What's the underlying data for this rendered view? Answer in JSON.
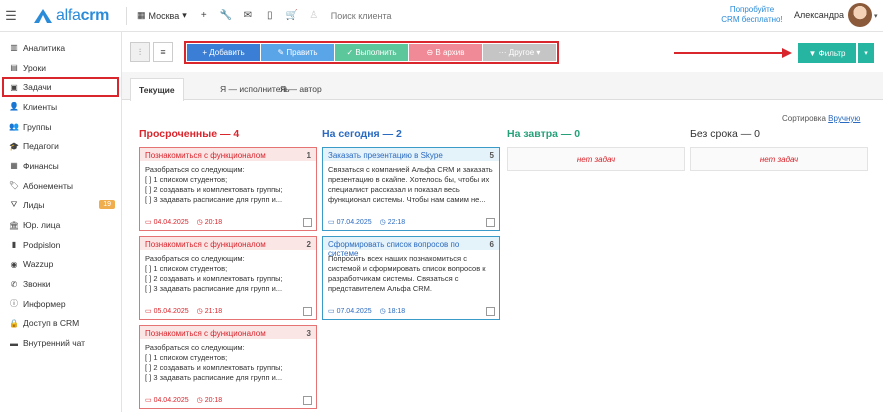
{
  "header": {
    "logo_light": "alfa",
    "logo_bold": "crm",
    "city": "Москва",
    "search_placeholder": "Поиск клиента",
    "promo_line1": "Попробуйте",
    "promo_line2": "CRM бесплатно!",
    "user_name": "Александра"
  },
  "sidebar": {
    "items": [
      {
        "label": "Аналитика",
        "icon": "chart-icon"
      },
      {
        "label": "Уроки",
        "icon": "lessons-icon"
      },
      {
        "label": "Задачи",
        "icon": "tasks-icon"
      },
      {
        "label": "Клиенты",
        "icon": "clients-icon"
      },
      {
        "label": "Группы",
        "icon": "groups-icon"
      },
      {
        "label": "Педагоги",
        "icon": "teachers-icon"
      },
      {
        "label": "Финансы",
        "icon": "finance-icon"
      },
      {
        "label": "Абонементы",
        "icon": "subscriptions-icon"
      },
      {
        "label": "Лиды",
        "icon": "leads-icon",
        "badge": "19"
      },
      {
        "label": "Юр. лица",
        "icon": "legal-icon"
      },
      {
        "label": "Podpislon",
        "icon": "document-icon"
      },
      {
        "label": "Wazzup",
        "icon": "whatsapp-icon"
      },
      {
        "label": "Звонки",
        "icon": "phone-icon"
      },
      {
        "label": "Информер",
        "icon": "informer-icon"
      },
      {
        "label": "Доступ в CRM",
        "icon": "lock-icon"
      },
      {
        "label": "Внутренний чат",
        "icon": "chat-icon"
      }
    ]
  },
  "toolbar": {
    "add": "+ Добавить",
    "edit": "✎ Править",
    "done": "✓ Выполнить",
    "archive": "⊖ В архив",
    "other": "··· Другое ▾",
    "filter": "▼ Фильтр"
  },
  "tabs": [
    "Текущие",
    "Я — исполнитель",
    "Я — автор"
  ],
  "sorting": {
    "label": "Сортировка",
    "value": "Вручную"
  },
  "columns": [
    {
      "title": "Просроченные — 4"
    },
    {
      "title": "На сегодня — 2"
    },
    {
      "title": "На завтра — 0",
      "empty": "нет задач"
    },
    {
      "title": "Без срока — 0",
      "empty": "нет задач"
    }
  ],
  "overdue_cards": [
    {
      "title": "Познакомиться с функционалом",
      "num": "1",
      "line1": "Разобраться со следующим:",
      "line2": "[ ] 1 списком студентов;",
      "line3": "[ ] 2 создавать и комплектовать группы;",
      "line4": "[ ] 3 задавать расписание для групп и...",
      "date": "04.04.2025",
      "time": "20:18"
    },
    {
      "title": "Познакомиться с функционалом",
      "num": "2",
      "line1": "Разобраться со следующим:",
      "line2": "[ ] 1 списком студентов;",
      "line3": "[ ] 2 создавать и комплектовать группы;",
      "line4": "[ ] 3 задавать расписание для групп и...",
      "date": "05.04.2025",
      "time": "21:18"
    },
    {
      "title": "Познакомиться с функционалом",
      "num": "3",
      "line1": "Разобраться со следующим:",
      "line2": "[ ] 1 списком студентов;",
      "line3": "[ ] 2 создавать и комплектовать группы;",
      "line4": "[ ] 3 задавать расписание для групп и...",
      "date": "04.04.2025",
      "time": "20:18"
    }
  ],
  "today_cards": [
    {
      "title": "Заказать презентацию в Skype",
      "num": "5",
      "line1": "Связаться с компанией Альфа CRM и заказать",
      "line2": "презентацию в скайпе. Хотелось бы, чтобы их",
      "line3": "специалист рассказал и показал весь",
      "line4": "функционал системы. Чтобы нам самим не...",
      "date": "07.04.2025",
      "time": "22:18"
    },
    {
      "title": "Сформировать список вопросов по системе",
      "num": "6",
      "line1": "Попросить всех наших познакомиться с",
      "line2": "системой и сформировать список вопросов к",
      "line3": "разработчикам системы. Связаться с",
      "line4": "представителем Альфа CRM.",
      "date": "07.04.2025",
      "time": "18:18"
    }
  ],
  "colors": {
    "accent": "#2a8bd9",
    "overdue": "#d9252c",
    "today": "#2a6ac0",
    "tomorrow": "#26a07a",
    "filter": "#26b5a0"
  }
}
